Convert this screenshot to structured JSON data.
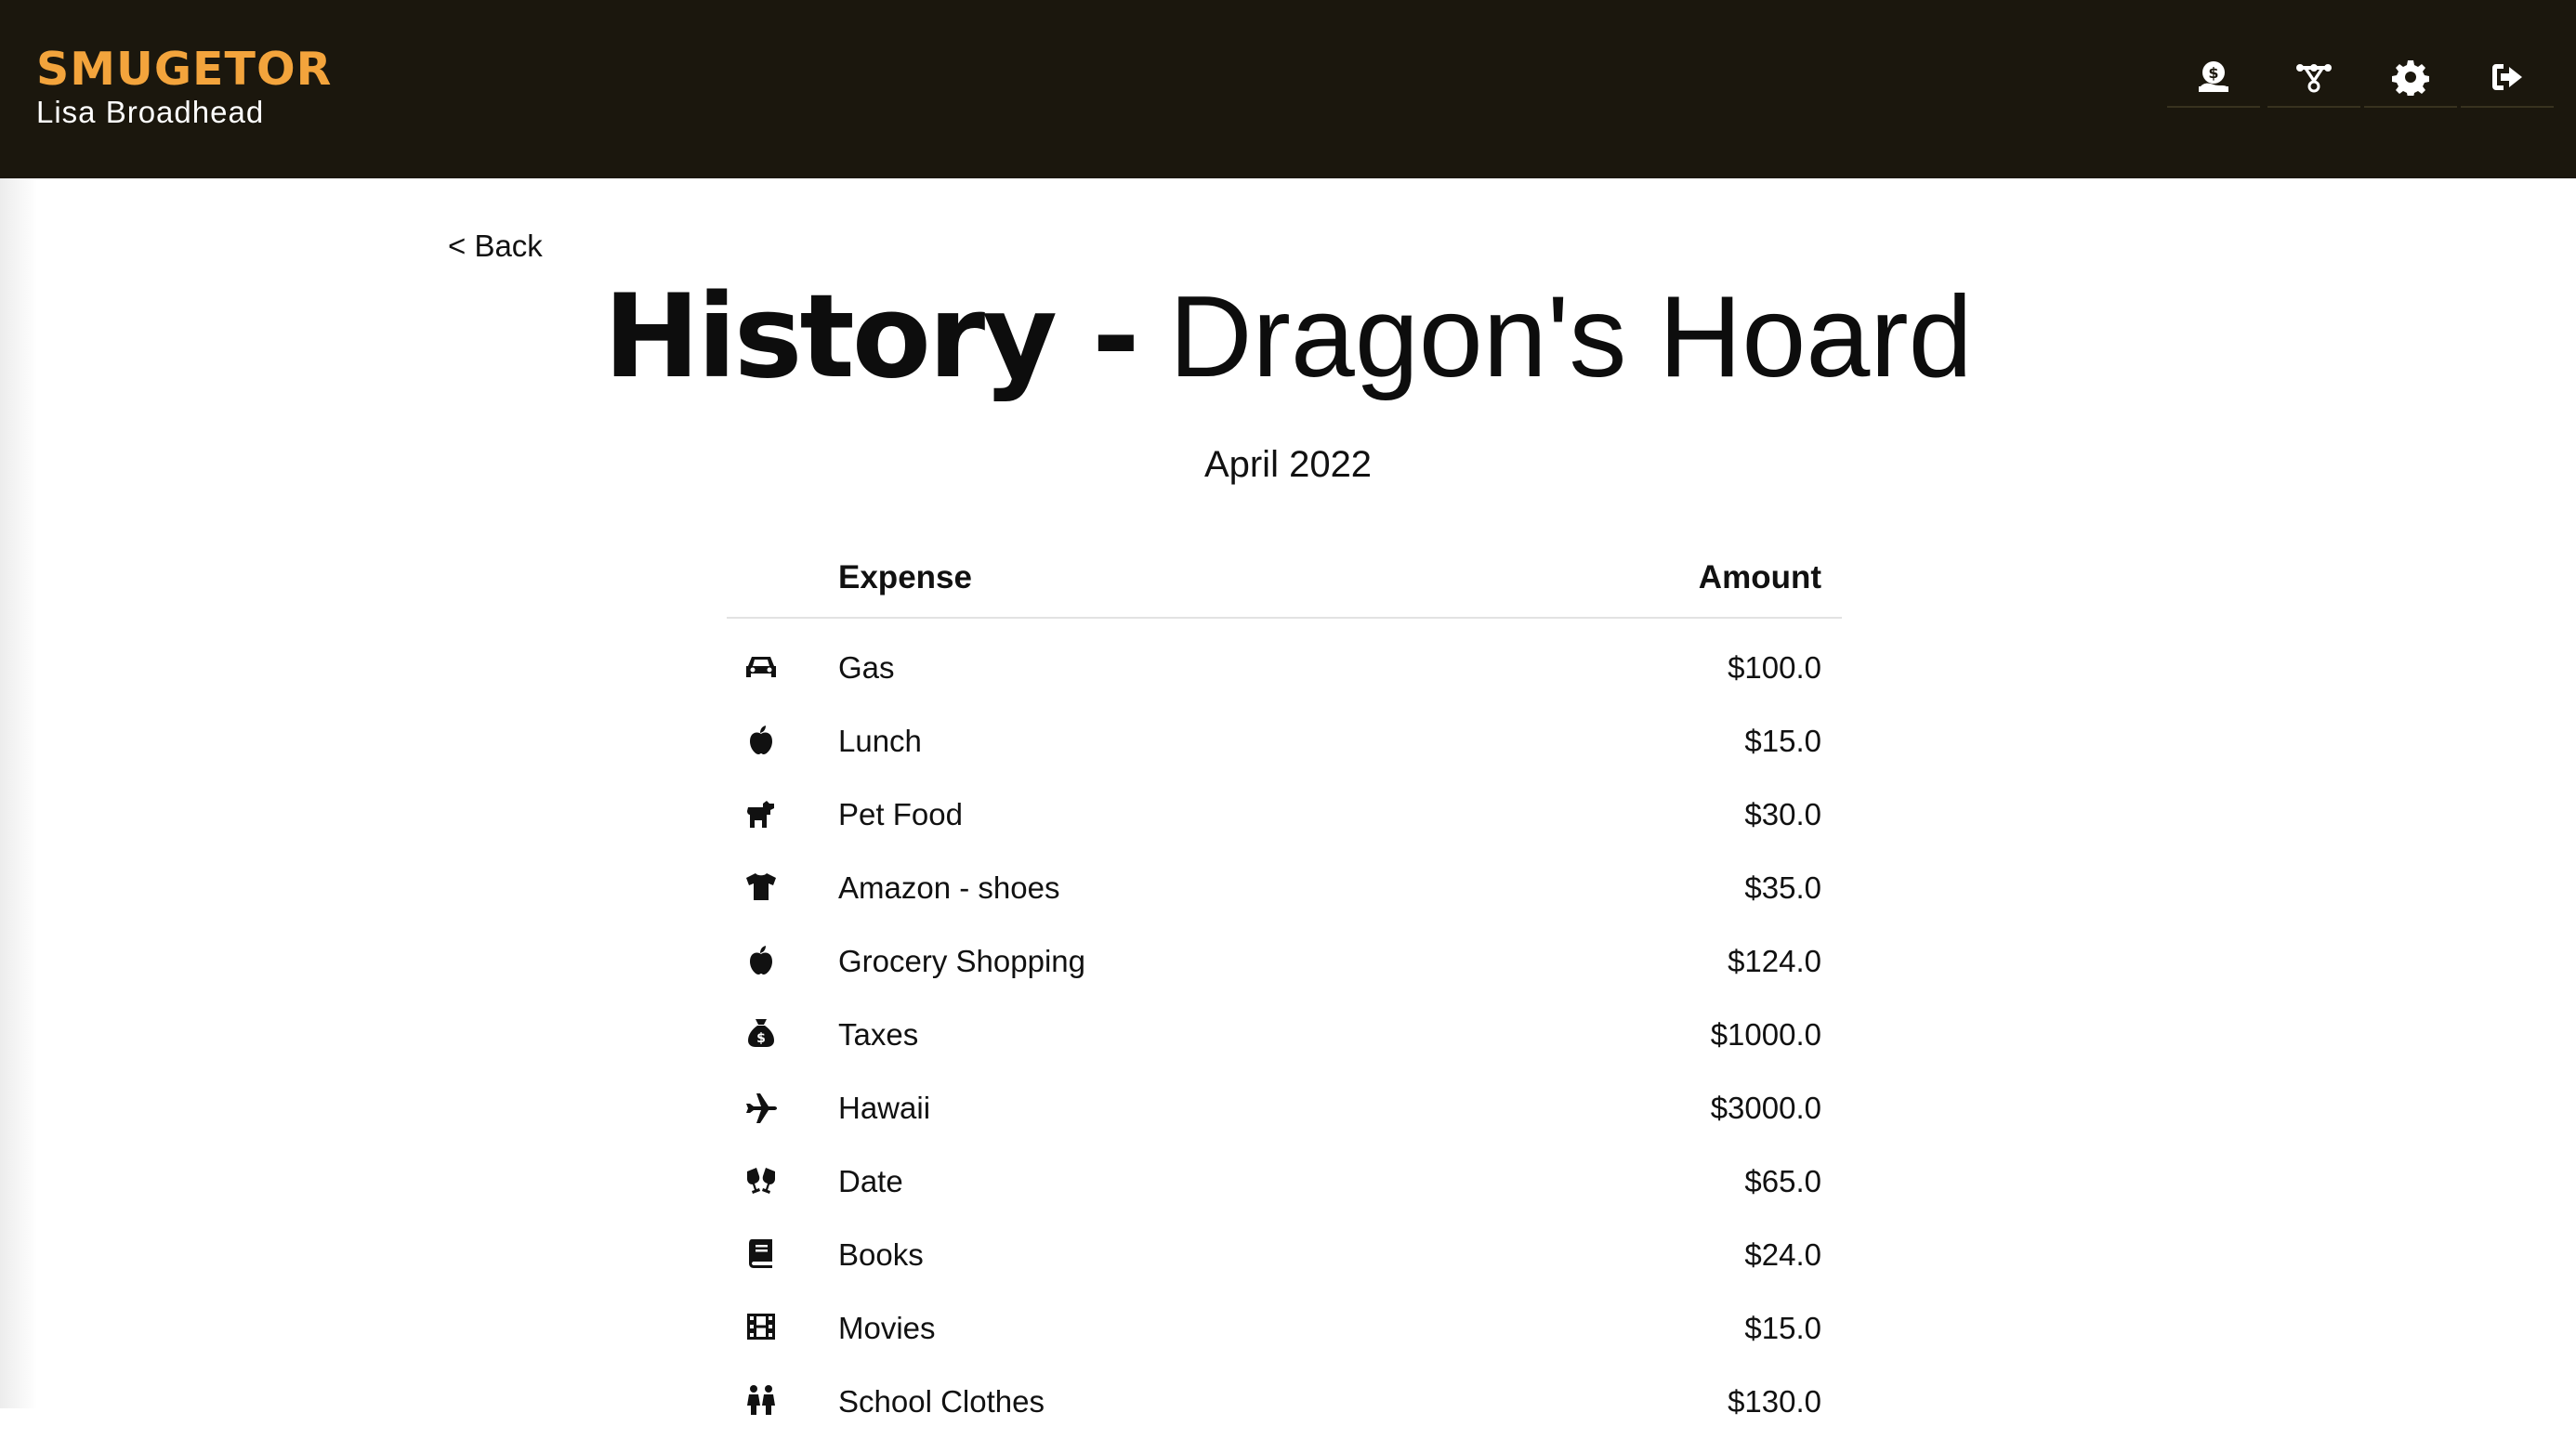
{
  "header": {
    "brand": "SMUGETOR",
    "user_name": "Lisa Broadhead",
    "nav": [
      {
        "icon": "money-hand-icon"
      },
      {
        "icon": "sitemap-icon"
      },
      {
        "icon": "gear-icon"
      },
      {
        "icon": "sign-out-icon"
      }
    ],
    "brand_color": "#f3a43c",
    "background": "#1b170d"
  },
  "back_link": "< Back",
  "title": {
    "bold": "History -",
    "light": " Dragon's Hoard"
  },
  "month": "April 2022",
  "table": {
    "columns": [
      "Expense",
      "Amount"
    ],
    "rows": [
      {
        "icon": "car-icon",
        "expense": "Gas",
        "amount": "$100.0"
      },
      {
        "icon": "apple-icon",
        "expense": "Lunch",
        "amount": "$15.0"
      },
      {
        "icon": "dog-icon",
        "expense": "Pet Food",
        "amount": "$30.0"
      },
      {
        "icon": "shirt-icon",
        "expense": "Amazon - shoes",
        "amount": "$35.0"
      },
      {
        "icon": "apple-icon",
        "expense": "Grocery Shopping",
        "amount": "$124.0"
      },
      {
        "icon": "money-bag-icon",
        "expense": "Taxes",
        "amount": "$1000.0"
      },
      {
        "icon": "plane-icon",
        "expense": "Hawaii",
        "amount": "$3000.0"
      },
      {
        "icon": "glasses-cheers-icon",
        "expense": "Date",
        "amount": "$65.0"
      },
      {
        "icon": "book-icon",
        "expense": "Books",
        "amount": "$24.0"
      },
      {
        "icon": "film-icon",
        "expense": "Movies",
        "amount": "$15.0"
      },
      {
        "icon": "children-icon",
        "expense": "School Clothes",
        "amount": "$130.0"
      }
    ]
  }
}
